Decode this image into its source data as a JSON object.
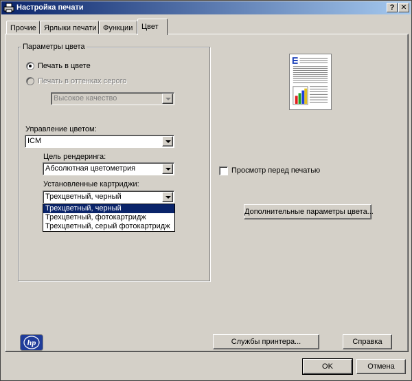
{
  "window": {
    "title": "Настройка печати",
    "help_btn": "?",
    "close_btn": "✕"
  },
  "tabs": [
    {
      "label": "Прочие"
    },
    {
      "label": "Ярлыки печати"
    },
    {
      "label": "Функции"
    },
    {
      "label": "Цвет"
    }
  ],
  "color_params": {
    "group_label": "Параметры цвета",
    "print_color": "Печать в цвете",
    "print_gray": "Печать в оттенках серого",
    "gray_quality": "Высокое качество",
    "color_mgmt_label": "Управление цветом:",
    "color_mgmt_value": "ICM",
    "render_label": "Цель рендеринга:",
    "render_value": "Абсолютная цветометрия",
    "cartridges_label": "Установленные картриджи:",
    "cartridges_value": "Трехцветный, черный",
    "cartridges_options": [
      "Трехцветный, черный",
      "Трехцветный, фотокартридж",
      "Трехцветный, серый фотокартридж"
    ]
  },
  "preview_check": "Просмотр перед печатью",
  "advanced_btn": "Дополнительные параметры цвета...",
  "hp_logo": "hp",
  "services_btn": "Службы принтера...",
  "help_btn": "Справка",
  "ok_btn": "OK",
  "cancel_btn": "Отмена",
  "colors": {
    "title_start": "#0a246a",
    "title_end": "#a6caf0",
    "selection": "#0a246a",
    "hp_blue": "#1f3c9a"
  }
}
